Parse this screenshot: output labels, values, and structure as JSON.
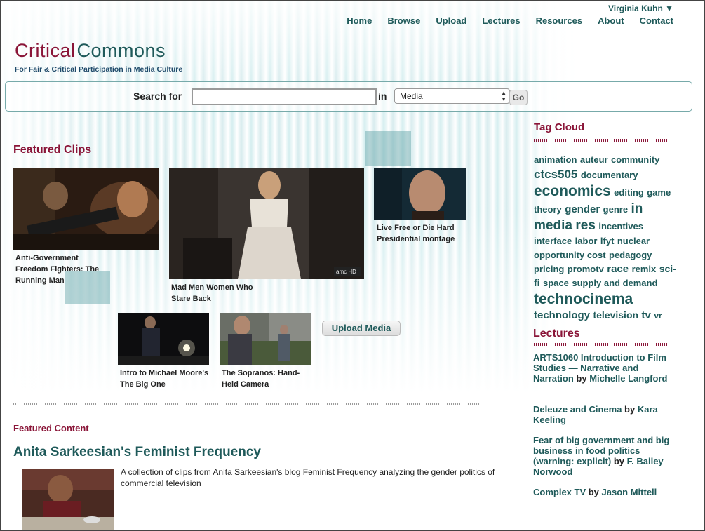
{
  "header": {
    "user": "Virginia Kuhn ▼",
    "nav": [
      "Home",
      "Browse",
      "Upload",
      "Lectures",
      "Resources",
      "About",
      "Contact"
    ],
    "logo_part1": "Critical",
    "logo_part2": "Commons",
    "tagline": "For Fair & Critical Participation in Media Culture"
  },
  "search": {
    "label": "Search for",
    "value": "",
    "in_label": "in",
    "scope_selected": "Media",
    "go_label": "Go"
  },
  "featured_clips": {
    "heading": "Featured Clips",
    "clips": [
      {
        "title": "Anti-Government Freedom Fighters: The Running Man"
      },
      {
        "title": "Mad Men Women Who Stare Back"
      },
      {
        "title": "Live Free or Die Hard Presidential montage"
      },
      {
        "title": "Intro to Michael Moore's The Big One"
      },
      {
        "title": "The Sopranos: Hand-Held Camera"
      }
    ],
    "upload_label": "Upload Media"
  },
  "featured_content": {
    "heading": "Featured Content",
    "title": "Anita Sarkeesian's Feminist Frequency",
    "description": "A collection of clips from Anita Sarkeesian's blog Feminist Frequency analyzing the gender politics of commercial television"
  },
  "sidebar": {
    "tag_cloud_heading": "Tag Cloud",
    "tags": [
      {
        "t": "animation",
        "s": 13
      },
      {
        "t": "auteur",
        "s": 13
      },
      {
        "t": "community",
        "s": 13
      },
      {
        "t": "ctcs505",
        "s": 17
      },
      {
        "t": "documentary",
        "s": 13
      },
      {
        "t": "economics",
        "s": 21
      },
      {
        "t": "editing",
        "s": 13
      },
      {
        "t": "game",
        "s": 13
      },
      {
        "t": "theory",
        "s": 13
      },
      {
        "t": "gender",
        "s": 15
      },
      {
        "t": "genre",
        "s": 13
      },
      {
        "t": "in",
        "s": 19
      },
      {
        "t": "media",
        "s": 19
      },
      {
        "t": "res",
        "s": 19
      },
      {
        "t": "incentives",
        "s": 13
      },
      {
        "t": "interface",
        "s": 13
      },
      {
        "t": "labor",
        "s": 13
      },
      {
        "t": "lfyt",
        "s": 13
      },
      {
        "t": "nuclear",
        "s": 13
      },
      {
        "t": "opportunity cost",
        "s": 13
      },
      {
        "t": "pedagogy",
        "s": 13
      },
      {
        "t": "pricing",
        "s": 13
      },
      {
        "t": "promotv",
        "s": 13
      },
      {
        "t": "race",
        "s": 15
      },
      {
        "t": "remix",
        "s": 13
      },
      {
        "t": "sci-fi",
        "s": 14
      },
      {
        "t": "space",
        "s": 13
      },
      {
        "t": "supply and demand",
        "s": 13
      },
      {
        "t": "technocinema",
        "s": 21
      },
      {
        "t": "technology",
        "s": 15
      },
      {
        "t": "television",
        "s": 14
      },
      {
        "t": "tv",
        "s": 15
      },
      {
        "t": "vr",
        "s": 12
      }
    ],
    "lectures_heading": "Lectures",
    "lectures": [
      {
        "title": "ARTS1060 Introduction to Film Studies — Narrative and Narration",
        "by": " by ",
        "author": "Michelle Langford"
      },
      {
        "title": "Deleuze and Cinema",
        "by": " by ",
        "author": "Kara Keeling"
      },
      {
        "title": "Fear of big government and big business in food politics (warning: explicit)",
        "by": " by ",
        "author": "F. Bailey Norwood"
      },
      {
        "title": "Complex TV",
        "by": " by ",
        "author": "Jason Mittell"
      }
    ]
  }
}
